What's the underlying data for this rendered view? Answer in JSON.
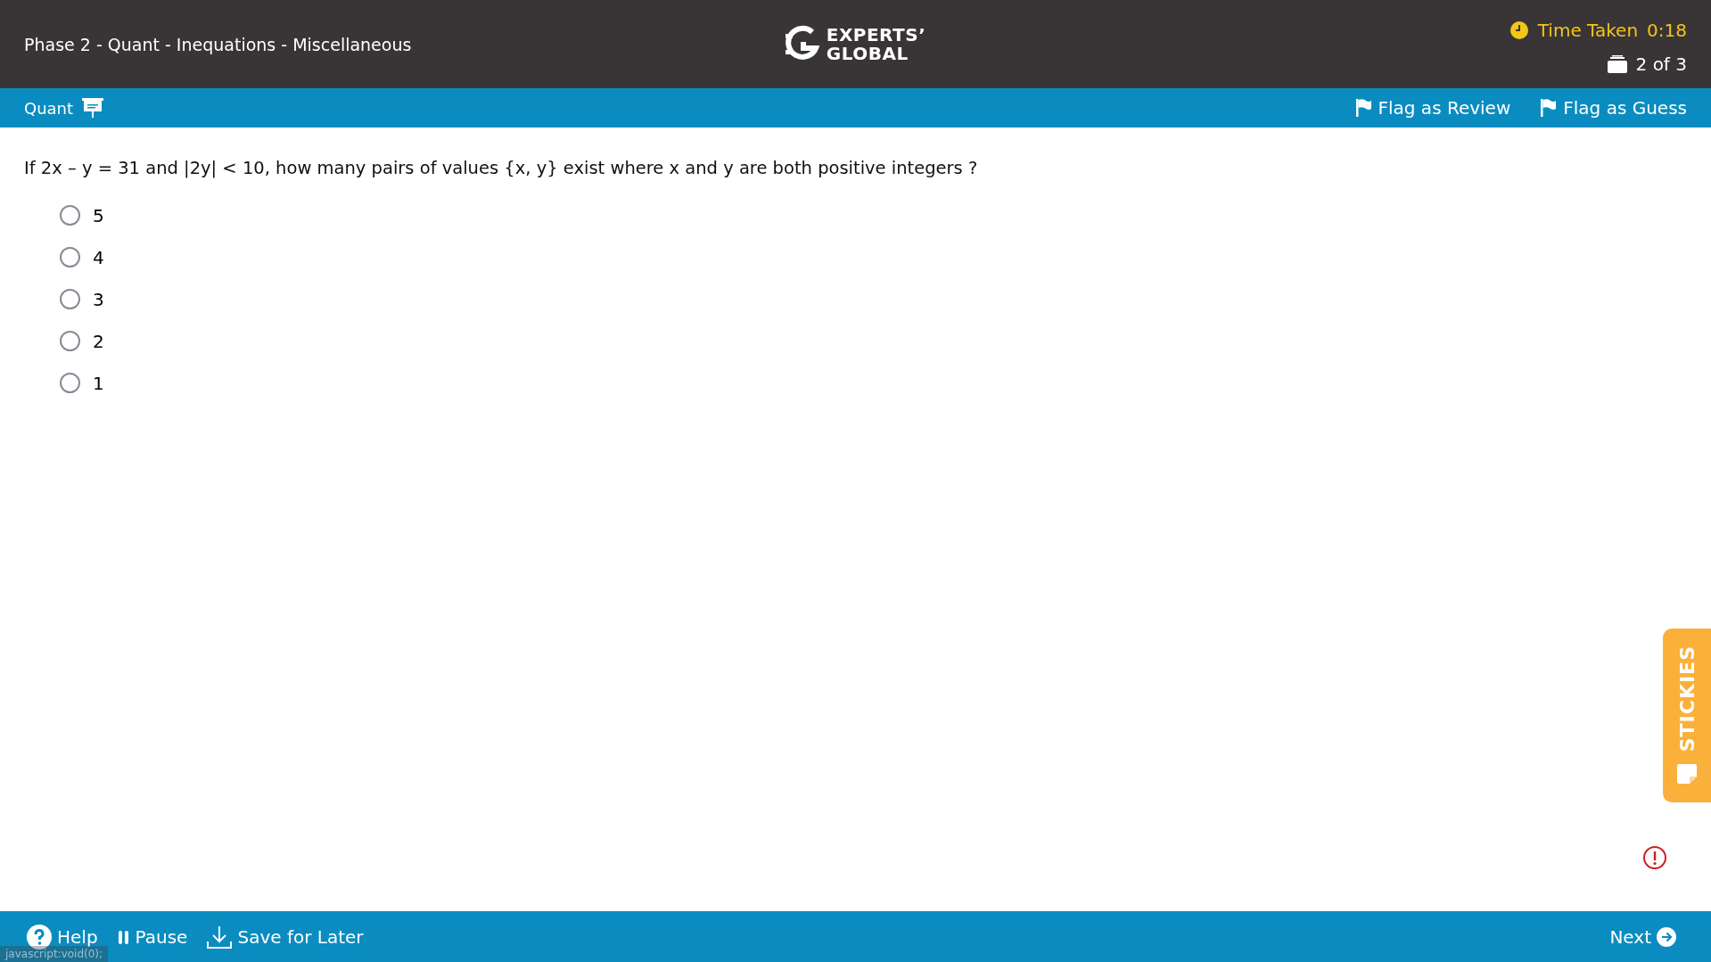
{
  "header": {
    "title": "Phase 2 - Quant - Inequations - Miscellaneous",
    "logo": [
      "EXPERTS’",
      "GLOBAL"
    ],
    "timer_label": "Time Taken",
    "timer_value": "0:18",
    "progress": "2 of 3"
  },
  "section_bar": {
    "section": "Quant",
    "flags": [
      "Flag as Review",
      "Flag as Guess"
    ]
  },
  "question": {
    "text": "If 2x – y = 31 and |2y| < 10, how many pairs of values {x, y} exist where x and y are both positive integers ?",
    "options": [
      {
        "label": "5",
        "selected": false
      },
      {
        "label": "4",
        "selected": false
      },
      {
        "label": "3",
        "selected": false
      },
      {
        "label": "2",
        "selected": false
      },
      {
        "label": "1",
        "selected": false
      }
    ]
  },
  "stickies": {
    "label": "STICKIES"
  },
  "footer": {
    "help": "Help",
    "pause": "Pause",
    "save": "Save for Later",
    "next": "Next"
  },
  "status_hint": "javascript:void(0);"
}
